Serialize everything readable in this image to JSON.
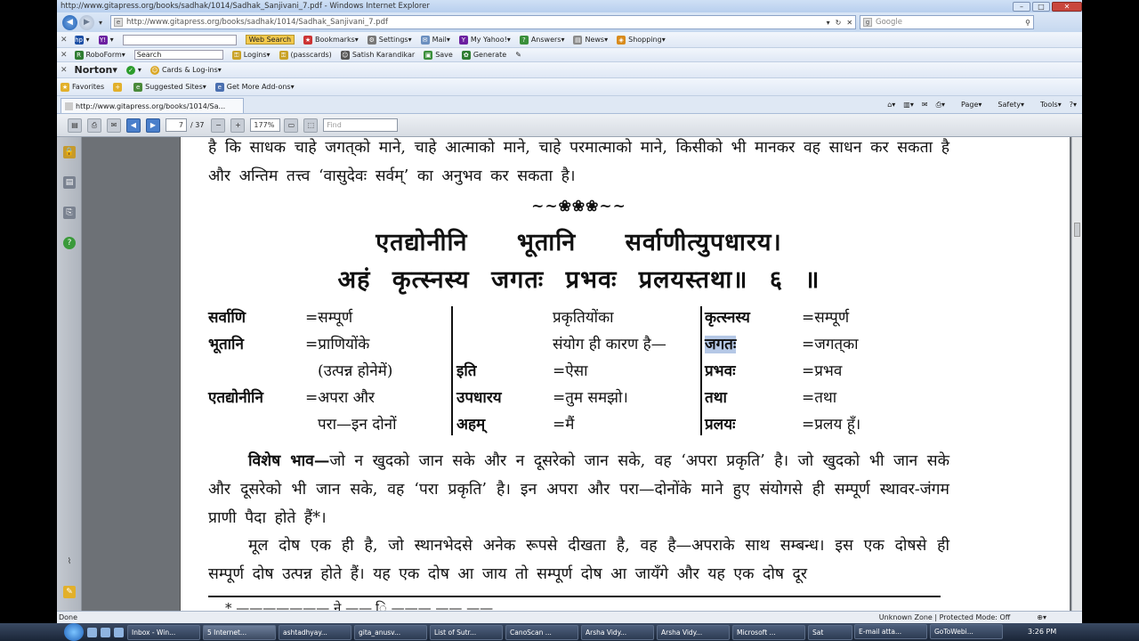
{
  "window": {
    "title": "http://www.gitapress.org/books/sadhak/1014/Sadhak_Sanjivani_7.pdf - Windows Internet Explorer"
  },
  "address": {
    "url": "http://www.gitapress.org/books/sadhak/1014/Sadhak_Sanjivani_7.pdf",
    "search_placeholder": "Google"
  },
  "yahoo_toolbar": {
    "search_button": "Web Search",
    "items": [
      "Bookmarks",
      "Settings",
      "Mail",
      "My Yahoo!",
      "Answers",
      "News",
      "Shopping"
    ]
  },
  "roboform_toolbar": {
    "items": [
      "RoboForm",
      "Search",
      "Logins",
      "(passcards)",
      "Satish Karandikar",
      "Save",
      "Generate"
    ]
  },
  "norton_toolbar": {
    "brand": "Norton",
    "item": "Cards & Log-ins"
  },
  "favorites_bar": {
    "items": [
      "Favorites",
      "Suggested Sites",
      "Get More Add-ons"
    ]
  },
  "tab": {
    "title": "http://www.gitapress.org/books/1014/Sa..."
  },
  "command_bar": {
    "items": [
      "Page",
      "Safety",
      "Tools"
    ]
  },
  "pdf_toolbar": {
    "page": "7",
    "total": "/ 37",
    "zoom": "177%",
    "find_placeholder": "Find"
  },
  "document": {
    "para0": "है कि साधक चाहे जगत्‌को माने, चाहे आत्माको माने, चाहे परमात्माको माने, किसीको भी मानकर वह साधन कर सकता है और अन्तिम तत्त्व ‘वासुदेवः सर्वम्’ का अनुभव कर सकता है।",
    "ornament": "~~❀❀❀~~",
    "verse1": "एतद्योनीनि भूतानि सर्वाणीत्युपधारय।",
    "verse2": "अहं कृत्स्नस्य जगतः प्रभवः प्रलयस्तथा॥ ६ ॥",
    "gloss_col1": [
      {
        "word": "सर्वाणि",
        "meaning": "=सम्पूर्ण"
      },
      {
        "word": "भूतानि",
        "meaning": "=प्राणियोंके"
      },
      {
        "word": "",
        "meaning": "(उत्पन्न होनेमें)"
      },
      {
        "word": "एतद्योनीनि",
        "meaning": "=अपरा और"
      },
      {
        "word": "",
        "meaning": "परा—इन दोनों"
      }
    ],
    "gloss_col2": [
      {
        "word": "",
        "meaning": "प्रकृतियोंका"
      },
      {
        "word": "",
        "meaning": "संयोग ही कारण है—"
      },
      {
        "word": "इति",
        "meaning": "=ऐसा"
      },
      {
        "word": "उपधारय",
        "meaning": "=तुम समझो।"
      },
      {
        "word": "अहम्",
        "meaning": "=मैं"
      }
    ],
    "gloss_col3": [
      {
        "word": "कृत्स्नस्य",
        "meaning": "=सम्पूर्ण"
      },
      {
        "word": "जगतः",
        "meaning": "=जगत्‌का"
      },
      {
        "word": "प्रभवः",
        "meaning": "=प्रभव"
      },
      {
        "word": "तथा",
        "meaning": "=तथा"
      },
      {
        "word": "प्रलयः",
        "meaning": "=प्रलय हूँ।"
      }
    ],
    "para1_lead": "विशेष भाव—",
    "para1": "जो न खुदको जान सके और न दूसरेको जान सके, वह ‘अपरा प्रकृति’ है। जो खुदको भी जान सके और दूसरेको भी जान सके, वह ‘परा प्रकृति’ है। इन अपरा और परा—दोनोंके माने हुए संयोगसे ही सम्पूर्ण स्थावर-जंगम प्राणी पैदा होते हैं*।",
    "para2": "मूल दोष एक ही है, जो स्थानभेदसे अनेक रूपसे दीखता है, वह है—अपराके साथ सम्बन्ध। इस एक दोषसे ही सम्पूर्ण दोष उत्पन्न होते हैं। यह एक दोष आ जाय तो सम्पूर्ण दोष आ जायँगे और यह एक दोष दूर",
    "footnote": "* ——————— ने —— ि ———  —— ——"
  },
  "status": {
    "left": "Done",
    "zone": "Unknown Zone | Protected Mode: Off"
  },
  "taskbar": {
    "tasks": [
      "Inbox - Win...",
      "5 Internet...",
      "ashtadhyay...",
      "gita_anusv...",
      "List of Sutr...",
      "CanoScan ...",
      "Arsha Vidy...",
      "Arsha Vidy...",
      "Microsoft ...",
      "Sat",
      "E-mail atta...",
      "GoToWebi..."
    ],
    "clock": "3:26 PM"
  },
  "colors": {
    "selection": "#b5c8e6",
    "chrome": "#dfe8f5"
  }
}
